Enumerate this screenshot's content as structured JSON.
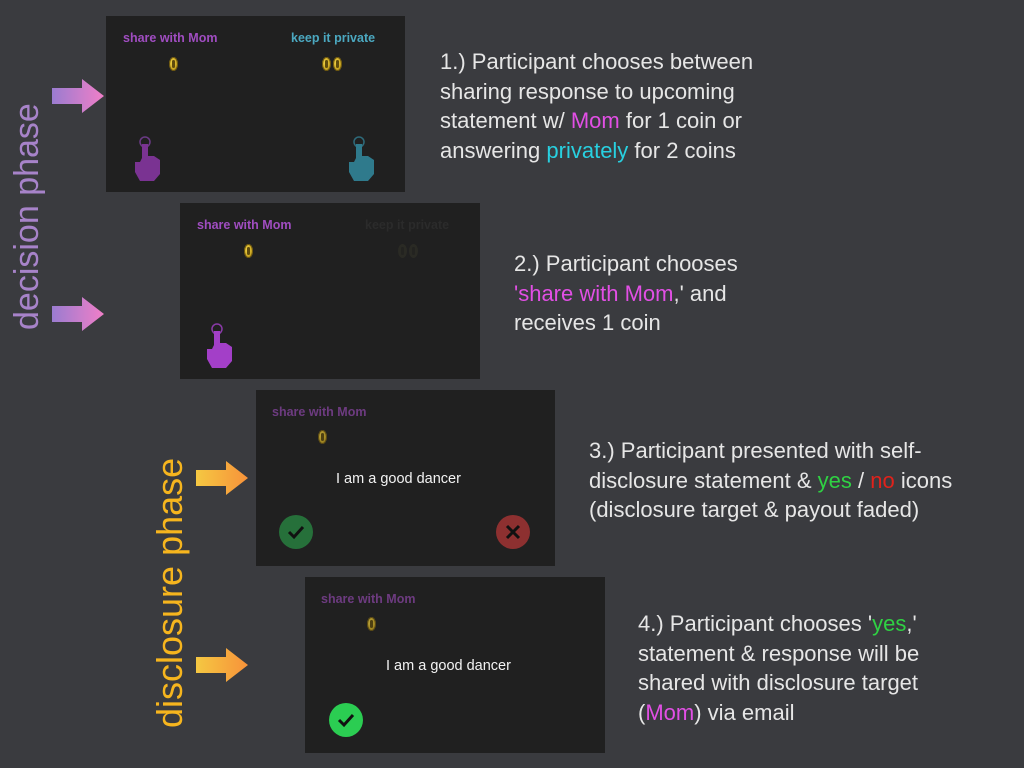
{
  "phases": {
    "decision": "decision phase",
    "disclosure": "disclosure phase"
  },
  "colors": {
    "decision_arrow": "#e07fd6",
    "disclosure_arrow": "#f7b733",
    "mom": "#e24fe5",
    "private": "#28d0e0",
    "yes": "#2fd143",
    "no": "#e0221b"
  },
  "screens": {
    "s1": {
      "left_option": "share with Mom",
      "right_option": "keep it private",
      "left_coins": 1,
      "right_coins": 2
    },
    "s2": {
      "left_option": "share with Mom",
      "right_option": "keep it private",
      "left_coins": 1,
      "right_coins": 2
    },
    "s3": {
      "option": "share with Mom",
      "statement": "I am a good dancer",
      "icons": [
        "check-icon",
        "x-icon"
      ]
    },
    "s4": {
      "option": "share with Mom",
      "statement": "I am a good dancer",
      "icons": [
        "check-icon"
      ]
    }
  },
  "captions": {
    "c1": {
      "l1": "1.) Participant chooses between",
      "l2": "sharing response to upcoming",
      "l3a": "statement w/ ",
      "l3b": "Mom",
      "l3c": " for 1 coin or",
      "l4a": "answering ",
      "l4b": "privately",
      "l4c": " for 2 coins"
    },
    "c2": {
      "l1": "2.) Participant chooses",
      "l2a": "'",
      "l2b": "share with Mom",
      "l2c": ",'  and",
      "l3": "receives 1 coin"
    },
    "c3": {
      "l1": "3.) Participant presented with self-",
      "l2a": "disclosure statement & ",
      "l2b": "yes",
      "l2c": " / ",
      "l2d": "no",
      "l2e": " icons",
      "l3": "(disclosure target & payout faded)"
    },
    "c4": {
      "l1a": "4.) Participant chooses '",
      "l1b": "yes",
      "l1c": ",'",
      "l2": "statement & response will be",
      "l3": "shared with disclosure target",
      "l4a": "(",
      "l4b": "Mom",
      "l4c": ") via email"
    }
  }
}
